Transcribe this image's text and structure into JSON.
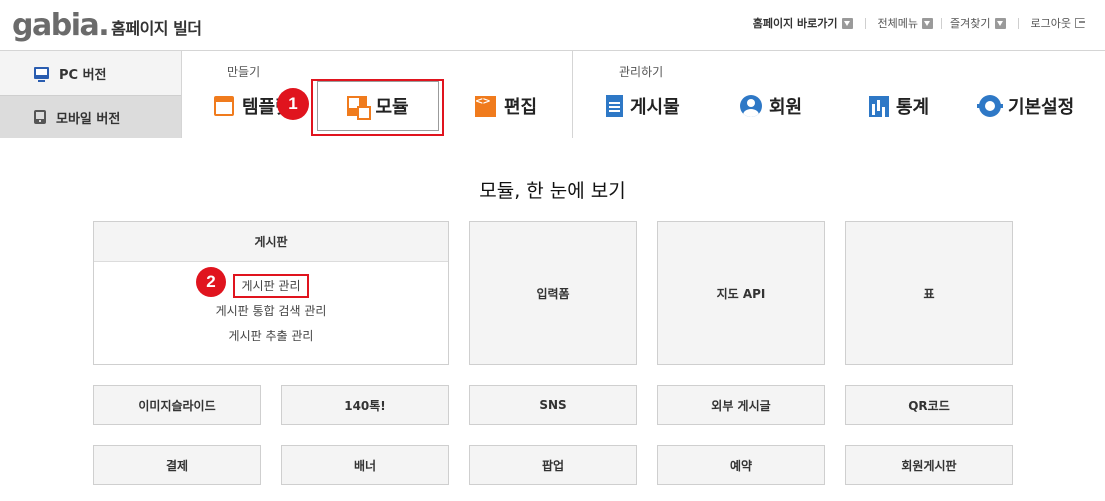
{
  "header": {
    "logo_text": "gabia.",
    "logo_sub": "홈페이지 빌더",
    "util": {
      "home_shortcut": "홈페이지 바로가기",
      "all_menu": "전체메뉴",
      "favorites": "즐겨찾기",
      "logout": "로그아웃"
    }
  },
  "platform": {
    "pc": "PC 버전",
    "mobile": "모바일 버전"
  },
  "make_section": {
    "label": "만들기",
    "tabs": {
      "template": "템플릿",
      "module": "모듈",
      "edit": "편집"
    }
  },
  "manage_section": {
    "label": "관리하기",
    "tabs": {
      "board": "게시물",
      "member": "회원",
      "stats": "통계",
      "settings": "기본설정"
    }
  },
  "markers": {
    "m1": "1",
    "m2": "2"
  },
  "content": {
    "title": "모듈, 한 눈에 보기",
    "board": {
      "heading": "게시판",
      "links": [
        "게시판 관리",
        "게시판 통합 검색 관리",
        "게시판 추출 관리"
      ]
    },
    "cards_top": [
      "입력폼",
      "지도 API",
      "표"
    ],
    "cards_row2": [
      "이미지슬라이드",
      "140톡!",
      "SNS",
      "외부 게시글",
      "QR코드"
    ],
    "cards_row3": [
      "결제",
      "배너",
      "팝업",
      "예약",
      "회원게시판"
    ]
  },
  "colors": {
    "accent_orange": "#f07b1d",
    "accent_blue": "#2e78c6",
    "highlight_red": "#e0141e"
  }
}
